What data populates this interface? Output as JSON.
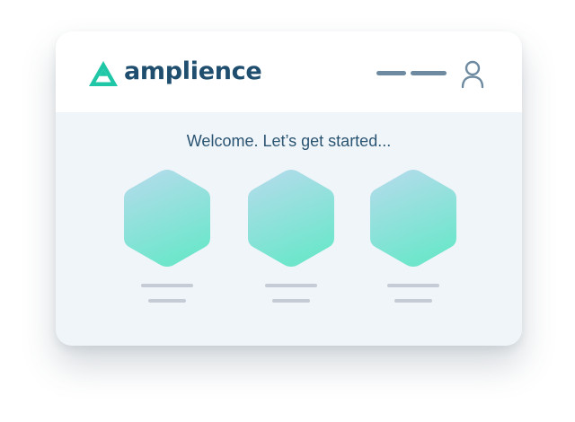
{
  "header": {
    "brand_name": "amplience",
    "menu_icon": "menu-bars-icon",
    "user_icon": "user-icon"
  },
  "main": {
    "welcome_text": "Welcome. Let’s get started...",
    "cards": [
      {
        "icon": "hexagon-icon"
      },
      {
        "icon": "hexagon-icon"
      },
      {
        "icon": "hexagon-icon"
      }
    ]
  },
  "colors": {
    "brand_text": "#1f4e6f",
    "logo_accent": "#1fc7a7",
    "header_bg": "#ffffff",
    "body_bg": "#eff5f9",
    "hex_gradient_top": "#b7dbed",
    "hex_gradient_bottom": "#6fe6cc",
    "placeholder_line": "#c6ccd6",
    "icon_stroke": "#6d8aa0"
  }
}
